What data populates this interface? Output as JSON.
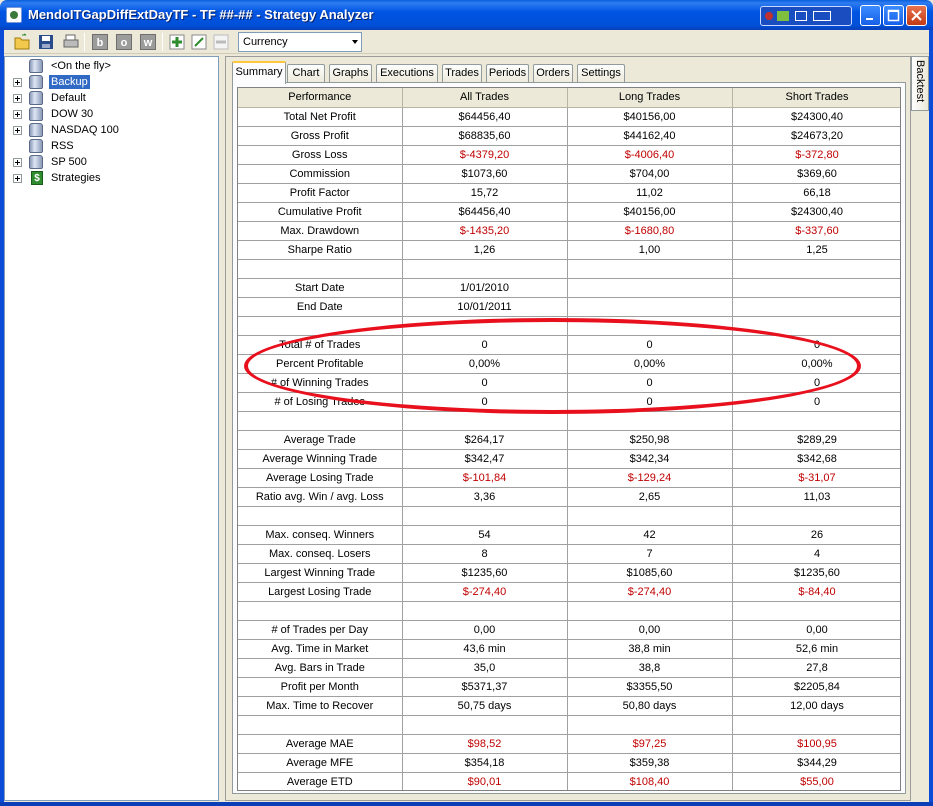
{
  "window": {
    "title": "MendoITGapDiffExtDayTF - TF ##-## - Strategy Analyzer"
  },
  "toolbar": {
    "letter_buttons": [
      "b",
      "o",
      "w"
    ],
    "currency": "Currency"
  },
  "sidebar": {
    "items": [
      {
        "label": "<On the fly>",
        "expander": false,
        "icon": "db-icon",
        "selected": false
      },
      {
        "label": "Backup",
        "expander": true,
        "icon": "db-icon",
        "selected": true
      },
      {
        "label": "Default",
        "expander": true,
        "icon": "db-icon",
        "selected": false
      },
      {
        "label": "DOW 30",
        "expander": true,
        "icon": "db-icon",
        "selected": false
      },
      {
        "label": "NASDAQ 100",
        "expander": true,
        "icon": "db-icon",
        "selected": false
      },
      {
        "label": "RSS",
        "expander": false,
        "icon": "db-icon",
        "selected": false
      },
      {
        "label": "SP 500",
        "expander": true,
        "icon": "db-icon",
        "selected": false
      },
      {
        "label": "Strategies",
        "expander": true,
        "icon": "dollar-icon",
        "selected": false
      }
    ]
  },
  "tabs": [
    "Summary",
    "Chart",
    "Graphs",
    "Executions",
    "Trades",
    "Periods",
    "Orders",
    "Settings"
  ],
  "active_tab": "Summary",
  "side_tab": "Backtest",
  "table": {
    "headers": [
      "Performance",
      "All Trades",
      "Long Trades",
      "Short Trades"
    ],
    "rows": [
      [
        "Total Net Profit",
        "$64456,40",
        "$40156,00",
        "$24300,40"
      ],
      [
        "Gross Profit",
        "$68835,60",
        "$44162,40",
        "$24673,20"
      ],
      [
        "Gross Loss",
        "$-4379,20",
        "$-4006,40",
        "$-372,80"
      ],
      [
        "Commission",
        "$1073,60",
        "$704,00",
        "$369,60"
      ],
      [
        "Profit Factor",
        "15,72",
        "11,02",
        "66,18"
      ],
      [
        "Cumulative Profit",
        "$64456,40",
        "$40156,00",
        "$24300,40"
      ],
      [
        "Max. Drawdown",
        "$-1435,20",
        "$-1680,80",
        "$-337,60"
      ],
      [
        "Sharpe Ratio",
        "1,26",
        "1,00",
        "1,25"
      ],
      [
        "",
        "",
        "",
        ""
      ],
      [
        "Start Date",
        "1/01/2010",
        "",
        ""
      ],
      [
        "End Date",
        "10/01/2011",
        "",
        ""
      ],
      [
        "",
        "",
        "",
        ""
      ],
      [
        "Total # of Trades",
        "0",
        "0",
        "0"
      ],
      [
        "Percent Profitable",
        "0,00%",
        "0,00%",
        "0,00%"
      ],
      [
        "# of Winning Trades",
        "0",
        "0",
        "0"
      ],
      [
        "# of Losing Trades",
        "0",
        "0",
        "0"
      ],
      [
        "",
        "",
        "",
        ""
      ],
      [
        "Average Trade",
        "$264,17",
        "$250,98",
        "$289,29"
      ],
      [
        "Average Winning Trade",
        "$342,47",
        "$342,34",
        "$342,68"
      ],
      [
        "Average Losing Trade",
        "$-101,84",
        "$-129,24",
        "$-31,07"
      ],
      [
        "Ratio avg. Win / avg. Loss",
        "3,36",
        "2,65",
        "11,03"
      ],
      [
        "",
        "",
        "",
        ""
      ],
      [
        "Max. conseq. Winners",
        "54",
        "42",
        "26"
      ],
      [
        "Max. conseq. Losers",
        "8",
        "7",
        "4"
      ],
      [
        "Largest Winning Trade",
        "$1235,60",
        "$1085,60",
        "$1235,60"
      ],
      [
        "Largest Losing Trade",
        "$-274,40",
        "$-274,40",
        "$-84,40"
      ],
      [
        "",
        "",
        "",
        ""
      ],
      [
        "# of Trades per Day",
        "0,00",
        "0,00",
        "0,00"
      ],
      [
        "Avg. Time in Market",
        "43,6 min",
        "38,8 min",
        "52,6 min"
      ],
      [
        "Avg. Bars in Trade",
        "35,0",
        "38,8",
        "27,8"
      ],
      [
        "Profit per Month",
        "$5371,37",
        "$3355,50",
        "$2205,84"
      ],
      [
        "Max. Time to Recover",
        "50,75 days",
        "50,80 days",
        "12,00 days"
      ],
      [
        "",
        "",
        "",
        ""
      ],
      [
        "Average MAE",
        "$98,52",
        "$97,25",
        "$100,95"
      ],
      [
        "Average MFE",
        "$354,18",
        "$359,38",
        "$344,29"
      ],
      [
        "Average ETD",
        "$90,01",
        "$108,40",
        "$55,00"
      ]
    ],
    "red_value_rows": [
      "Gross Loss",
      "Max. Drawdown",
      "Average Losing Trade",
      "Largest Losing Trade",
      "Average MAE",
      "Average ETD"
    ]
  },
  "colors": {
    "negative_text": "#c00000",
    "annotation": "#e8101c",
    "selection": "#316ac5",
    "titlebar": "#0054e3"
  }
}
